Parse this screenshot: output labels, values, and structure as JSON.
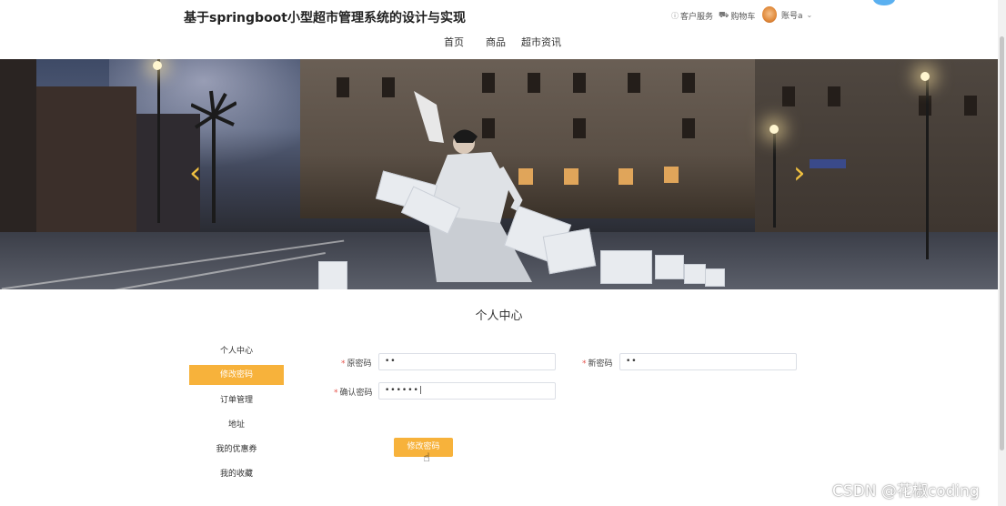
{
  "header": {
    "site_title": "基于springboot小型超市管理系统的设计与实现",
    "nav": [
      {
        "label": "首页"
      },
      {
        "label": "商品"
      },
      {
        "label": "超市资讯"
      }
    ],
    "top_right": {
      "customer_service": "客户服务",
      "cart": "购物车",
      "account": "账号a"
    }
  },
  "banner": {
    "prev_arrow": "‹",
    "next_arrow": "›"
  },
  "page": {
    "section_title": "个人中心"
  },
  "sidebar": {
    "items": [
      {
        "label": "个人中心",
        "active": false
      },
      {
        "label": "修改密码",
        "active": true
      },
      {
        "label": "订单管理",
        "active": false
      },
      {
        "label": "地址",
        "active": false
      },
      {
        "label": "我的优惠券",
        "active": false
      },
      {
        "label": "我的收藏",
        "active": false
      }
    ]
  },
  "form": {
    "old_password": {
      "label": "原密码",
      "value": "••"
    },
    "new_password": {
      "label": "新密码",
      "value": "••"
    },
    "confirm_password": {
      "label": "确认密码",
      "value": "••••••|"
    },
    "submit_label": "修改密码"
  },
  "watermark": "CSDN @花椒coding",
  "colors": {
    "accent": "#f7b23b",
    "required": "#e5534b"
  }
}
